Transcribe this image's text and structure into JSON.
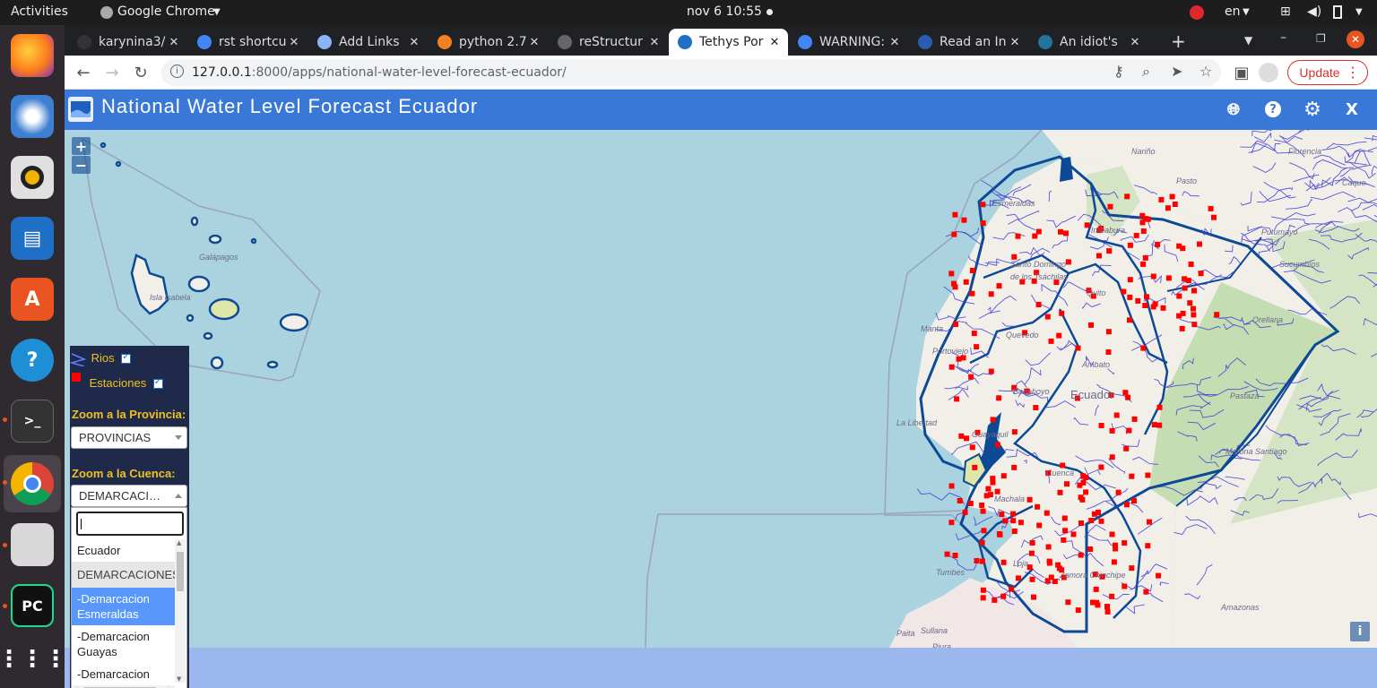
{
  "system": {
    "activities": "Activities",
    "app_menu": "Google Chrome",
    "clock": "nov 6  10:55",
    "lang": "en"
  },
  "tabs": [
    {
      "label": "karynina3/",
      "icon": "github-icon",
      "active": false
    },
    {
      "label": "rst shortcu",
      "icon": "google-icon",
      "active": false
    },
    {
      "label": "Add Links",
      "icon": "document-icon",
      "active": false
    },
    {
      "label": "python 2.7",
      "icon": "stackoverflow-icon",
      "active": false
    },
    {
      "label": "reStructur",
      "icon": "sphinx-icon",
      "active": false
    },
    {
      "label": "Tethys Por",
      "icon": "tethys-icon",
      "active": true
    },
    {
      "label": "WARNING:",
      "icon": "google-icon",
      "active": false
    },
    {
      "label": "Read an In",
      "icon": "read-icon",
      "active": false
    },
    {
      "label": "An idiot's",
      "icon": "wordpress-icon",
      "active": false
    }
  ],
  "url": {
    "host": "127.0.0.1",
    "path": ":8000/apps/national-water-level-forecast-ecuador/"
  },
  "update_label": "Update",
  "app": {
    "title": "National Water Level Forecast Ecuador",
    "close_label": "X"
  },
  "map": {
    "zoom_in": "+",
    "zoom_out": "−",
    "info": "i",
    "labels": [
      "Galápagos",
      "Isla Isabela",
      "Nariño",
      "Florencia",
      "Pasto",
      "Caque",
      "Putumayo",
      "Sucumbíos",
      "Santo Domingo",
      "de los Tsáchilas",
      "Quito",
      "Orellana",
      "Pastaza",
      "Manta",
      "Portoviejo",
      "Quevedo",
      "Babahoyo",
      "Ambato",
      "Ecuador",
      "La Libertad",
      "Guayaquil",
      "Cuenca",
      "Morona Santiago",
      "Machala",
      "Tumbes",
      "Loja",
      "Zamora Chinchipe",
      "Amazonas",
      "Paita",
      "Sullana",
      "Piura",
      "Esmeraldas",
      "Imbabura"
    ]
  },
  "legend": {
    "rivers": "Rios",
    "stations": "Estaciones"
  },
  "province": {
    "label": "Zoom a la Provincia:",
    "value": "PROVINCIAS"
  },
  "basin": {
    "label": "Zoom a la Cuenca:",
    "value": "DEMARCACIONES",
    "search_value": "",
    "options": [
      {
        "text": "Ecuador",
        "type": "option"
      },
      {
        "text": "DEMARCACIONES",
        "type": "group"
      },
      {
        "text": "-Demarcacion Esmeraldas",
        "type": "highlighted"
      },
      {
        "text": "-Demarcacion Guayas",
        "type": "option"
      },
      {
        "text": "-Demarcacion",
        "type": "option"
      }
    ]
  },
  "colors": {
    "header": "#3a78d8",
    "ocean": "#aad3df",
    "land": "#f2efe9",
    "river": "#3b3bd4",
    "boundary": "#0c4a96",
    "station": "#ff0000",
    "forest": "#b8d8a4"
  }
}
